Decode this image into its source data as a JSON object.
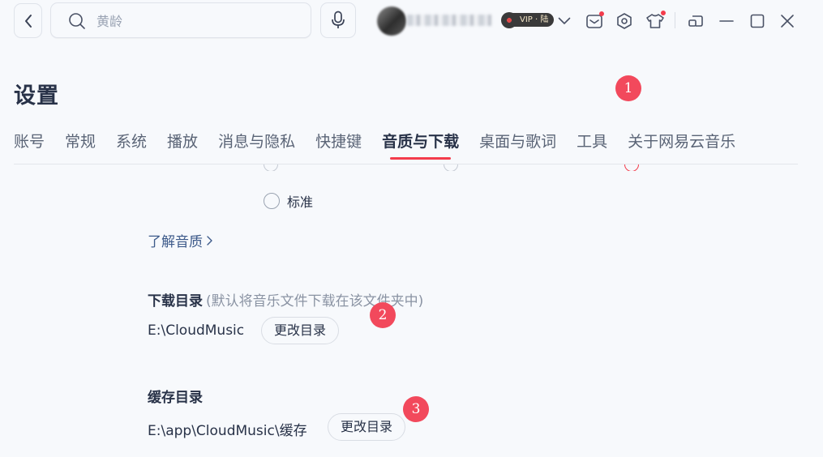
{
  "topbar": {
    "search_placeholder": "黄龄",
    "vip_label": "VIP · 陆"
  },
  "page": {
    "title": "设置"
  },
  "tabs": [
    {
      "label": "账号",
      "active": false
    },
    {
      "label": "常规",
      "active": false
    },
    {
      "label": "系统",
      "active": false
    },
    {
      "label": "播放",
      "active": false
    },
    {
      "label": "消息与隐私",
      "active": false
    },
    {
      "label": "快捷键",
      "active": false
    },
    {
      "label": "音质与下载",
      "active": true
    },
    {
      "label": "桌面与歌词",
      "active": false
    },
    {
      "label": "工具",
      "active": false
    },
    {
      "label": "关于网易云音乐",
      "active": false
    }
  ],
  "quality": {
    "standard_label": "标准",
    "learn_link": "了解音质"
  },
  "download_dir": {
    "heading": "下载目录",
    "hint": "(默认将音乐文件下载在该文件夹中)",
    "path": "E:\\CloudMusic",
    "button": "更改目录"
  },
  "cache_dir": {
    "heading": "缓存目录",
    "path": "E:\\app\\CloudMusic\\缓存",
    "button": "更改目录"
  },
  "markers": [
    "1",
    "2",
    "3"
  ],
  "colors": {
    "accent": "#f33c4c",
    "marker": "#f2495c",
    "link": "#3d5a8a",
    "background": "#f7f9fc"
  },
  "icons": [
    "chevron-left-icon",
    "search-icon",
    "microphone-icon",
    "chevron-down-icon",
    "mail-icon",
    "settings-hexagon-icon",
    "skin-shirt-icon",
    "mini-mode-icon",
    "minimize-icon",
    "maximize-icon",
    "close-icon",
    "chevron-right-icon"
  ]
}
